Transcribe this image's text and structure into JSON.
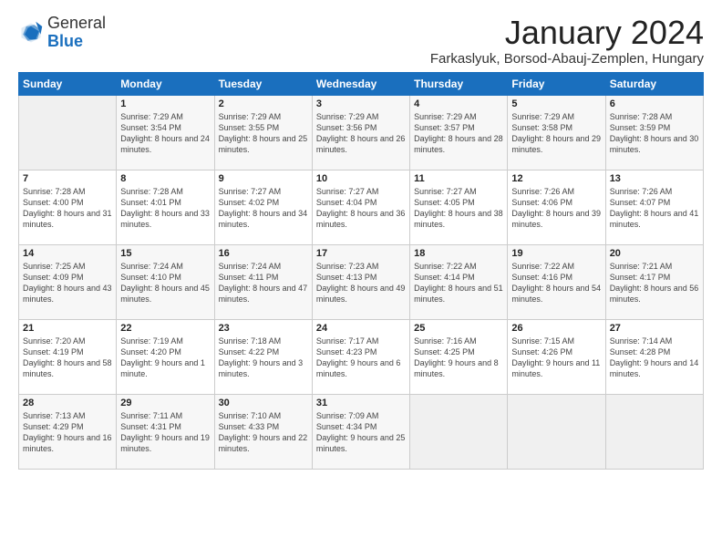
{
  "header": {
    "logo_general": "General",
    "logo_blue": "Blue",
    "month": "January 2024",
    "location": "Farkaslyuk, Borsod-Abauj-Zemplen, Hungary"
  },
  "days_of_week": [
    "Sunday",
    "Monday",
    "Tuesday",
    "Wednesday",
    "Thursday",
    "Friday",
    "Saturday"
  ],
  "weeks": [
    [
      {
        "day": "",
        "sunrise": "",
        "sunset": "",
        "daylight": ""
      },
      {
        "day": "1",
        "sunrise": "Sunrise: 7:29 AM",
        "sunset": "Sunset: 3:54 PM",
        "daylight": "Daylight: 8 hours and 24 minutes."
      },
      {
        "day": "2",
        "sunrise": "Sunrise: 7:29 AM",
        "sunset": "Sunset: 3:55 PM",
        "daylight": "Daylight: 8 hours and 25 minutes."
      },
      {
        "day": "3",
        "sunrise": "Sunrise: 7:29 AM",
        "sunset": "Sunset: 3:56 PM",
        "daylight": "Daylight: 8 hours and 26 minutes."
      },
      {
        "day": "4",
        "sunrise": "Sunrise: 7:29 AM",
        "sunset": "Sunset: 3:57 PM",
        "daylight": "Daylight: 8 hours and 28 minutes."
      },
      {
        "day": "5",
        "sunrise": "Sunrise: 7:29 AM",
        "sunset": "Sunset: 3:58 PM",
        "daylight": "Daylight: 8 hours and 29 minutes."
      },
      {
        "day": "6",
        "sunrise": "Sunrise: 7:28 AM",
        "sunset": "Sunset: 3:59 PM",
        "daylight": "Daylight: 8 hours and 30 minutes."
      }
    ],
    [
      {
        "day": "7",
        "sunrise": "Sunrise: 7:28 AM",
        "sunset": "Sunset: 4:00 PM",
        "daylight": "Daylight: 8 hours and 31 minutes."
      },
      {
        "day": "8",
        "sunrise": "Sunrise: 7:28 AM",
        "sunset": "Sunset: 4:01 PM",
        "daylight": "Daylight: 8 hours and 33 minutes."
      },
      {
        "day": "9",
        "sunrise": "Sunrise: 7:27 AM",
        "sunset": "Sunset: 4:02 PM",
        "daylight": "Daylight: 8 hours and 34 minutes."
      },
      {
        "day": "10",
        "sunrise": "Sunrise: 7:27 AM",
        "sunset": "Sunset: 4:04 PM",
        "daylight": "Daylight: 8 hours and 36 minutes."
      },
      {
        "day": "11",
        "sunrise": "Sunrise: 7:27 AM",
        "sunset": "Sunset: 4:05 PM",
        "daylight": "Daylight: 8 hours and 38 minutes."
      },
      {
        "day": "12",
        "sunrise": "Sunrise: 7:26 AM",
        "sunset": "Sunset: 4:06 PM",
        "daylight": "Daylight: 8 hours and 39 minutes."
      },
      {
        "day": "13",
        "sunrise": "Sunrise: 7:26 AM",
        "sunset": "Sunset: 4:07 PM",
        "daylight": "Daylight: 8 hours and 41 minutes."
      }
    ],
    [
      {
        "day": "14",
        "sunrise": "Sunrise: 7:25 AM",
        "sunset": "Sunset: 4:09 PM",
        "daylight": "Daylight: 8 hours and 43 minutes."
      },
      {
        "day": "15",
        "sunrise": "Sunrise: 7:24 AM",
        "sunset": "Sunset: 4:10 PM",
        "daylight": "Daylight: 8 hours and 45 minutes."
      },
      {
        "day": "16",
        "sunrise": "Sunrise: 7:24 AM",
        "sunset": "Sunset: 4:11 PM",
        "daylight": "Daylight: 8 hours and 47 minutes."
      },
      {
        "day": "17",
        "sunrise": "Sunrise: 7:23 AM",
        "sunset": "Sunset: 4:13 PM",
        "daylight": "Daylight: 8 hours and 49 minutes."
      },
      {
        "day": "18",
        "sunrise": "Sunrise: 7:22 AM",
        "sunset": "Sunset: 4:14 PM",
        "daylight": "Daylight: 8 hours and 51 minutes."
      },
      {
        "day": "19",
        "sunrise": "Sunrise: 7:22 AM",
        "sunset": "Sunset: 4:16 PM",
        "daylight": "Daylight: 8 hours and 54 minutes."
      },
      {
        "day": "20",
        "sunrise": "Sunrise: 7:21 AM",
        "sunset": "Sunset: 4:17 PM",
        "daylight": "Daylight: 8 hours and 56 minutes."
      }
    ],
    [
      {
        "day": "21",
        "sunrise": "Sunrise: 7:20 AM",
        "sunset": "Sunset: 4:19 PM",
        "daylight": "Daylight: 8 hours and 58 minutes."
      },
      {
        "day": "22",
        "sunrise": "Sunrise: 7:19 AM",
        "sunset": "Sunset: 4:20 PM",
        "daylight": "Daylight: 9 hours and 1 minute."
      },
      {
        "day": "23",
        "sunrise": "Sunrise: 7:18 AM",
        "sunset": "Sunset: 4:22 PM",
        "daylight": "Daylight: 9 hours and 3 minutes."
      },
      {
        "day": "24",
        "sunrise": "Sunrise: 7:17 AM",
        "sunset": "Sunset: 4:23 PM",
        "daylight": "Daylight: 9 hours and 6 minutes."
      },
      {
        "day": "25",
        "sunrise": "Sunrise: 7:16 AM",
        "sunset": "Sunset: 4:25 PM",
        "daylight": "Daylight: 9 hours and 8 minutes."
      },
      {
        "day": "26",
        "sunrise": "Sunrise: 7:15 AM",
        "sunset": "Sunset: 4:26 PM",
        "daylight": "Daylight: 9 hours and 11 minutes."
      },
      {
        "day": "27",
        "sunrise": "Sunrise: 7:14 AM",
        "sunset": "Sunset: 4:28 PM",
        "daylight": "Daylight: 9 hours and 14 minutes."
      }
    ],
    [
      {
        "day": "28",
        "sunrise": "Sunrise: 7:13 AM",
        "sunset": "Sunset: 4:29 PM",
        "daylight": "Daylight: 9 hours and 16 minutes."
      },
      {
        "day": "29",
        "sunrise": "Sunrise: 7:11 AM",
        "sunset": "Sunset: 4:31 PM",
        "daylight": "Daylight: 9 hours and 19 minutes."
      },
      {
        "day": "30",
        "sunrise": "Sunrise: 7:10 AM",
        "sunset": "Sunset: 4:33 PM",
        "daylight": "Daylight: 9 hours and 22 minutes."
      },
      {
        "day": "31",
        "sunrise": "Sunrise: 7:09 AM",
        "sunset": "Sunset: 4:34 PM",
        "daylight": "Daylight: 9 hours and 25 minutes."
      },
      {
        "day": "",
        "sunrise": "",
        "sunset": "",
        "daylight": ""
      },
      {
        "day": "",
        "sunrise": "",
        "sunset": "",
        "daylight": ""
      },
      {
        "day": "",
        "sunrise": "",
        "sunset": "",
        "daylight": ""
      }
    ]
  ]
}
